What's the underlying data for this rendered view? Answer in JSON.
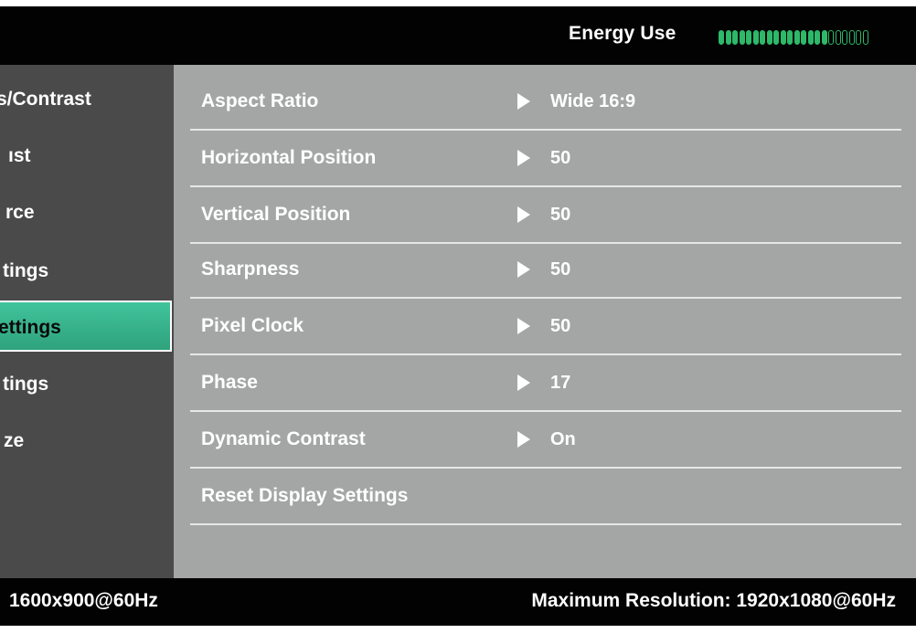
{
  "header": {
    "energy_label": "Energy Use",
    "energy_level_on_segments": 16,
    "energy_level_total_segments": 22,
    "meter_color": "#2eb86a"
  },
  "sidebar": {
    "items": [
      {
        "label": "s/Contrast",
        "active": false
      },
      {
        "label": "ıst",
        "active": false
      },
      {
        "label": "rce",
        "active": false
      },
      {
        "label": "tings",
        "active": false
      },
      {
        "label": "ettings",
        "active": true
      },
      {
        "label": "tings",
        "active": false
      },
      {
        "label": "ze",
        "active": false
      }
    ],
    "active_color": "#2eb38a"
  },
  "settings": {
    "rows": [
      {
        "label": "Aspect Ratio",
        "value": "Wide 16:9",
        "has_arrow": true
      },
      {
        "label": "Horizontal Position",
        "value": "50",
        "has_arrow": true
      },
      {
        "label": "Vertical Position",
        "value": "50",
        "has_arrow": true
      },
      {
        "label": "Sharpness",
        "value": "50",
        "has_arrow": true
      },
      {
        "label": "Pixel Clock",
        "value": "50",
        "has_arrow": true
      },
      {
        "label": "Phase",
        "value": "17",
        "has_arrow": true
      },
      {
        "label": "Dynamic Contrast",
        "value": "On",
        "has_arrow": true
      },
      {
        "label": "Reset Display Settings",
        "value": "",
        "has_arrow": false
      }
    ]
  },
  "footer": {
    "current_resolution": "1600x900@60Hz",
    "max_resolution": "Maximum Resolution: 1920x1080@60Hz"
  }
}
